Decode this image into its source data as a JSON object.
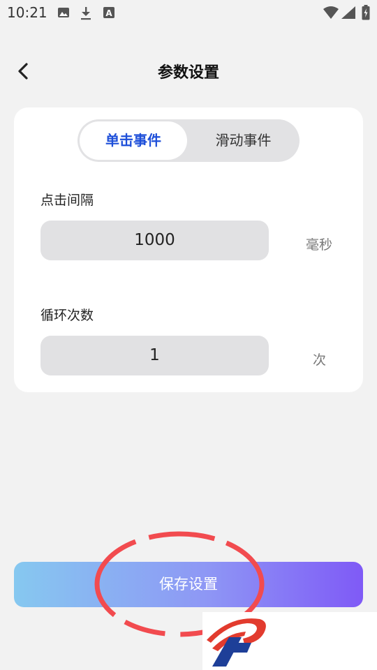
{
  "status_bar": {
    "time": "10:21",
    "icons": [
      "gallery-icon",
      "download-icon",
      "a-icon",
      "wifi-icon",
      "signal-icon",
      "battery-charging-icon"
    ]
  },
  "header": {
    "back_icon": "chevron-left-icon",
    "title": "参数设置"
  },
  "tabs": [
    {
      "label": "单击事件",
      "active": true
    },
    {
      "label": "滑动事件",
      "active": false
    }
  ],
  "fields": {
    "click_interval": {
      "label": "点击间隔",
      "value": "1000",
      "unit": "毫秒"
    },
    "loop_count": {
      "label": "循环次数",
      "value": "1",
      "unit": "次"
    }
  },
  "save_button": {
    "label": "保存设置"
  },
  "colors": {
    "accent": "#1e4fd9",
    "gradient_start": "#86c8f0",
    "gradient_end": "#7f5af6",
    "highlight_ring": "#f24b4f",
    "background": "#f2f2f2"
  },
  "watermark_logo": "logo-icon"
}
